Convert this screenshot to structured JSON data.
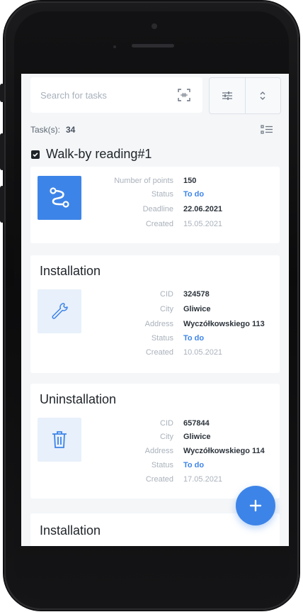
{
  "search": {
    "placeholder": "Search for tasks"
  },
  "tasks": {
    "label": "Task(s):",
    "count": "34"
  },
  "cards": [
    {
      "title": "Walk-by reading#1",
      "icon": "route-icon",
      "rows": [
        {
          "label": "Number of points",
          "value": "150"
        },
        {
          "label": "Status",
          "value": "To do"
        },
        {
          "label": "Deadline",
          "value": "22.06.2021"
        },
        {
          "label": "Created",
          "value": "15.05.2021"
        }
      ]
    },
    {
      "title": "Installation",
      "icon": "wrench-icon",
      "rows": [
        {
          "label": "CID",
          "value": "324578"
        },
        {
          "label": "City",
          "value": "Gliwice"
        },
        {
          "label": "Address",
          "value": "Wyczółkowskiego 113"
        },
        {
          "label": "Status",
          "value": "To do"
        },
        {
          "label": "Created",
          "value": "10.05.2021"
        }
      ]
    },
    {
      "title": "Uninstallation",
      "icon": "trash-icon",
      "rows": [
        {
          "label": "CID",
          "value": "657844"
        },
        {
          "label": "City",
          "value": "Gliwice"
        },
        {
          "label": "Address",
          "value": "Wyczółkowskiego 114"
        },
        {
          "label": "Status",
          "value": "To do"
        },
        {
          "label": "Created",
          "value": "17.05.2021"
        }
      ]
    },
    {
      "title": "Installation",
      "icon": "wrench-icon",
      "rows": []
    }
  ],
  "fab": {
    "label": "+"
  },
  "colors": {
    "accent": "#3d84e8",
    "background": "#f4f6f8",
    "card": "#ffffff",
    "muted_text": "#aab2bc"
  }
}
